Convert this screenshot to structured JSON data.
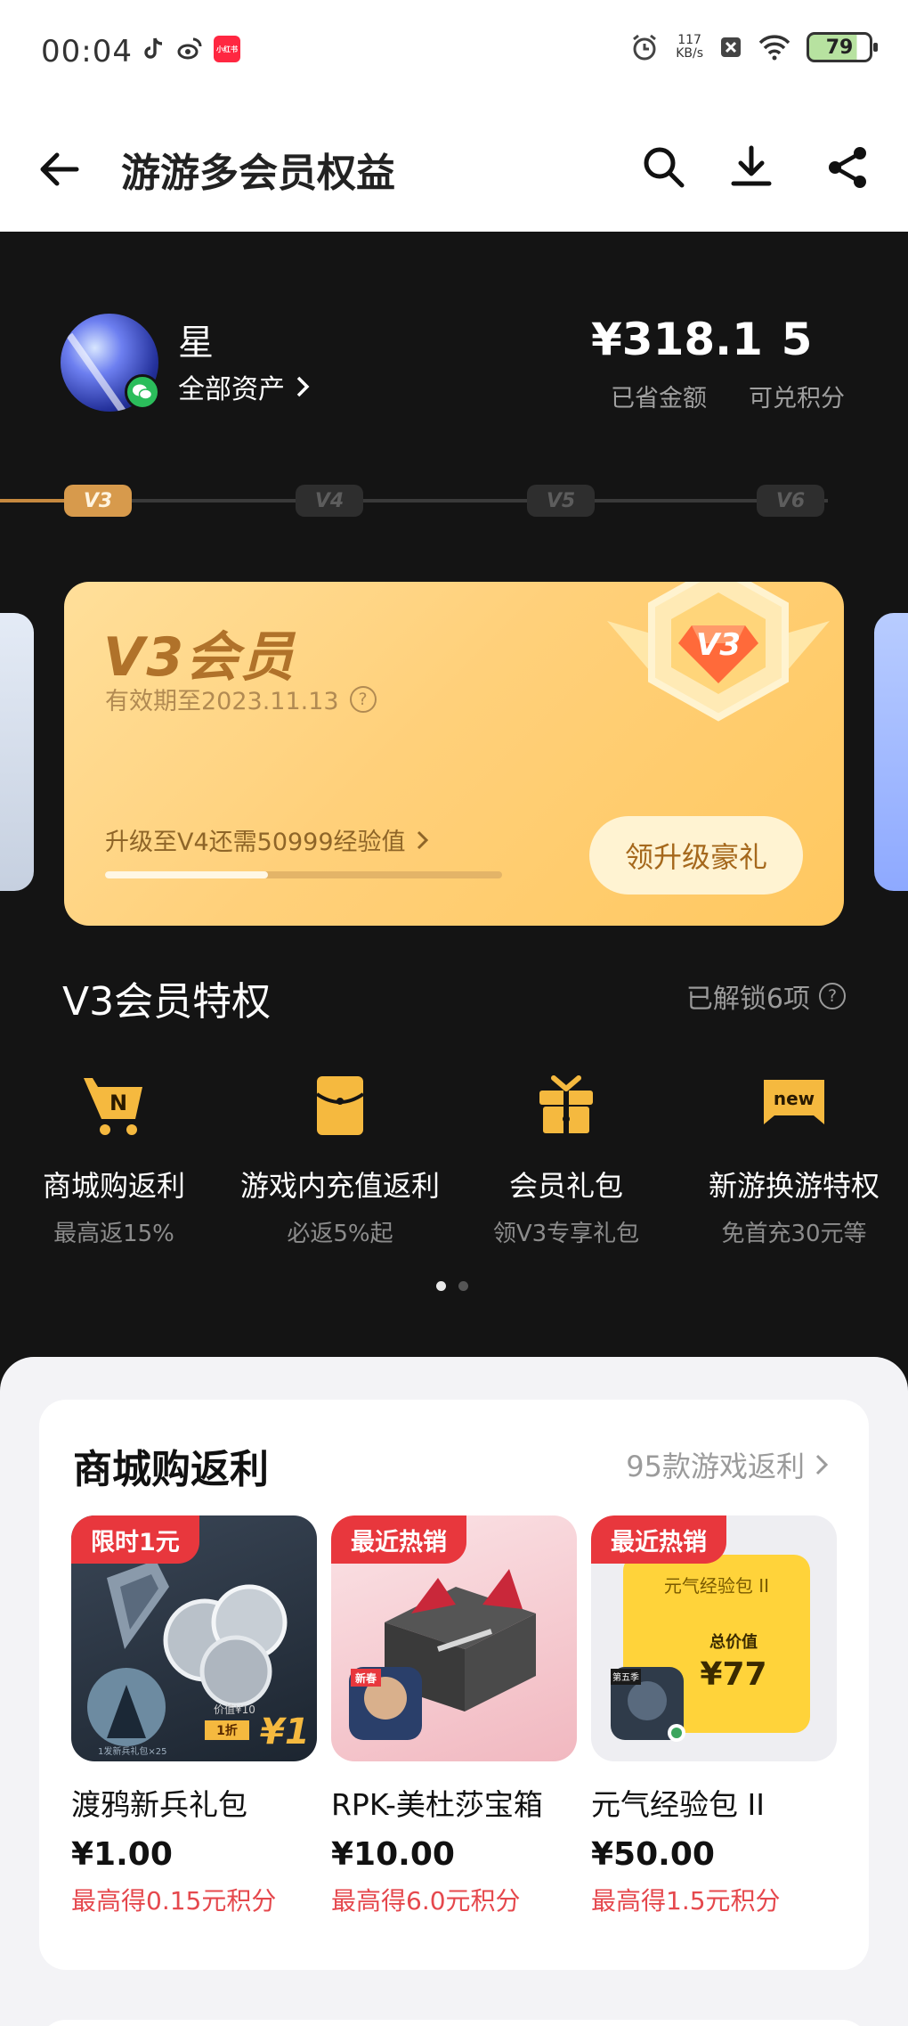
{
  "status_bar": {
    "time": "00:04",
    "net_speed_value": "117",
    "net_speed_unit": "KB/s",
    "battery": "79",
    "app_icons": [
      "tiktok-icon",
      "weibo-icon",
      "xiaohongshu-icon"
    ],
    "xiaohongshu_label": "小红书"
  },
  "header": {
    "title": "游游多会员权益"
  },
  "profile": {
    "name": "星",
    "assets_link": "全部资产",
    "saved_amount": "¥318.1",
    "saved_label": "已省金额",
    "points": "5",
    "points_label": "可兑积分"
  },
  "levels": [
    "V3",
    "V4",
    "V5",
    "V6"
  ],
  "member_card": {
    "title": "V3会员",
    "valid_until": "有效期至2023.11.13",
    "upgrade_hint": "升级至V4还需50999经验值",
    "progress_fraction": 0.41,
    "upgrade_button": "领升级豪礼",
    "badge_text": "V3"
  },
  "privileges": {
    "title": "V3会员特权",
    "unlocked": "已解锁6项",
    "items": [
      {
        "name": "商城购返利",
        "sub": "最高返15%",
        "icon": "cart-icon",
        "icon_text": "N"
      },
      {
        "name": "游戏内充值返利",
        "sub": "必返5%起",
        "icon": "red-envelope-icon"
      },
      {
        "name": "会员礼包",
        "sub": "领V3专享礼包",
        "icon": "gift-icon"
      },
      {
        "name": "新游换游特权",
        "sub": "免首充30元等",
        "icon": "new-tag-icon",
        "icon_text": "new"
      }
    ],
    "page_count": 2,
    "active_page": 0
  },
  "mall": {
    "title": "商城购返利",
    "more": "95款游戏返利",
    "products": [
      {
        "tag": "限时1元",
        "name": "渡鸦新兵礼包",
        "price": "¥1.00",
        "points": "最高得0.15元积分",
        "img_text_worth": "价值¥10",
        "img_text_discount": "1折",
        "img_text_price": "¥1",
        "img_caption": "1发新兵礼包×25"
      },
      {
        "tag": "最近热销",
        "name": "RPK-美杜莎宝箱",
        "price": "¥10.00",
        "points": "最高得6.0元积分",
        "img_badge": "新春"
      },
      {
        "tag": "最近热销",
        "name": "元气经验包 II",
        "price": "¥50.00",
        "points": "最高得1.5元积分",
        "img_title": "元气经验包 II",
        "img_total": "总价值",
        "img_value": "¥77",
        "img_badge": "第五季"
      }
    ]
  },
  "colors": {
    "dark_bg": "#141414",
    "gold_card": "#ffd07a",
    "accent_red": "#e8373d",
    "points_red": "#e5484d",
    "level_active": "#d79a4c"
  }
}
